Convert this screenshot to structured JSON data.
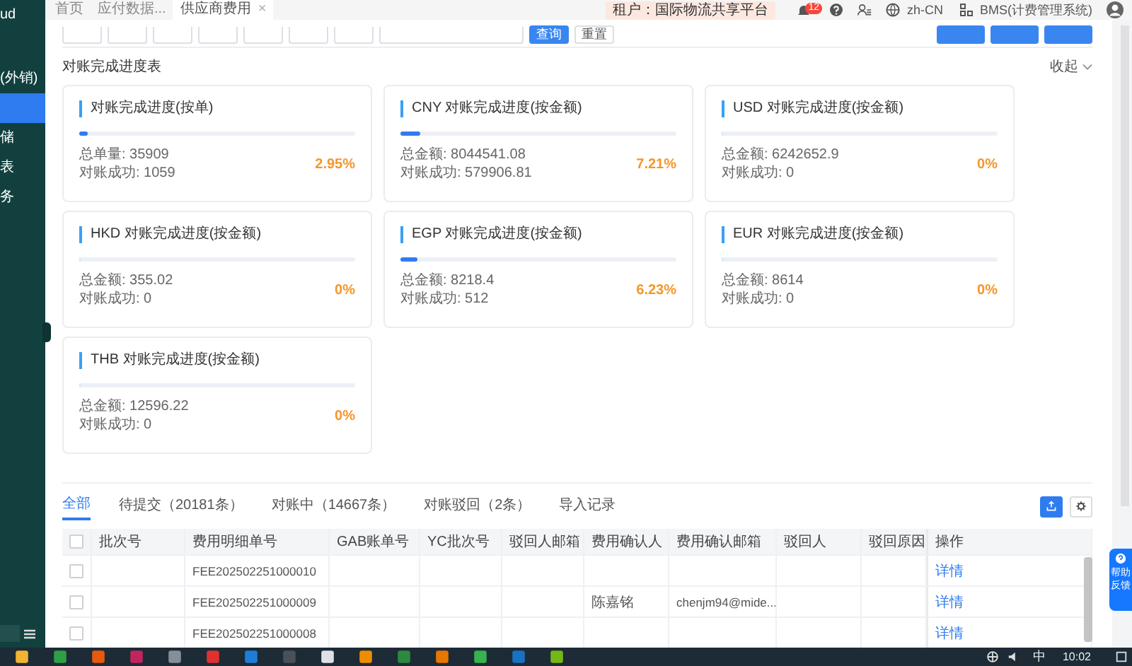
{
  "sidebar": {
    "items": [
      {
        "label": "ud",
        "selected": false
      },
      {
        "label": "(外销)",
        "selected": false
      },
      {
        "selected": true
      },
      {
        "label": "储",
        "selected": false
      },
      {
        "label": "表",
        "selected": false
      },
      {
        "label": "务",
        "selected": false
      }
    ]
  },
  "page_tabs": [
    {
      "label": "首页",
      "selected": false
    },
    {
      "label": "应付数据...",
      "selected": false
    },
    {
      "label": "供应商费用",
      "selected": true,
      "close": "×"
    }
  ],
  "header": {
    "tenant": "租户：国际物流共享平台",
    "notification_count": "12",
    "language": "zh-CN",
    "system": "BMS(计费管理系统)"
  },
  "filters": [
    {
      "kind": "input"
    },
    {
      "kind": "input"
    },
    {
      "kind": "input"
    },
    {
      "kind": "input"
    },
    {
      "kind": "input"
    },
    {
      "kind": "input"
    },
    {
      "kind": "input"
    },
    {
      "kind": "date"
    }
  ],
  "filter_buttons": [
    {
      "label": "查询",
      "primary": true
    },
    {
      "label": "重置",
      "primary": false
    }
  ],
  "action_buttons": [
    {
      "primary": true
    },
    {
      "primary": true
    },
    {
      "primary": true
    }
  ],
  "progress_section": {
    "title": "对账完成进度表",
    "collapse": "收起",
    "cards": [
      {
        "title": "对账完成进度(按单)",
        "level": 0.0295,
        "lines": [
          "总单量: 35909",
          "对账成功: 1059"
        ],
        "percent": "2.95%"
      },
      {
        "title": "CNY 对账完成进度(按金额)",
        "level": 0.0721,
        "lines": [
          "总金额: 8044541.08",
          "对账成功: 579906.81"
        ],
        "percent": "7.21%"
      },
      {
        "title": "USD 对账完成进度(按金额)",
        "level": 0,
        "lines": [
          "总金额: 6242652.9",
          "对账成功: 0"
        ],
        "percent": "0%"
      },
      {
        "title": "HKD 对账完成进度(按金额)",
        "level": 0,
        "lines": [
          "总金额: 355.02",
          "对账成功: 0"
        ],
        "percent": "0%"
      },
      {
        "title": "EGP 对账完成进度(按金额)",
        "level": 0.0623,
        "lines": [
          "总金额: 8218.4",
          "对账成功: 512"
        ],
        "percent": "6.23%"
      },
      {
        "title": "EUR 对账完成进度(按金额)",
        "level": 0,
        "lines": [
          "总金额: 8614",
          "对账成功: 0"
        ],
        "percent": "0%"
      },
      {
        "title": "THB 对账完成进度(按金额)",
        "level": 0,
        "lines": [
          "总金额: 12596.22",
          "对账成功: 0"
        ],
        "percent": "0%"
      }
    ]
  },
  "list_tabs": [
    {
      "label": "全部",
      "selected": true
    },
    {
      "label": "待提交（20181条）",
      "selected": false
    },
    {
      "label": "对账中（14667条）",
      "selected": false
    },
    {
      "label": "对账驳回（2条）",
      "selected": false
    },
    {
      "label": "导入记录",
      "selected": false
    }
  ],
  "table": {
    "select_all_checked": false,
    "columns": [
      "批次号",
      "费用明细单号",
      "GAB账单号",
      "YC批次号",
      "驳回人邮箱",
      "费用确认人",
      "费用确认邮箱",
      "驳回人",
      "驳回原因",
      "操作"
    ],
    "rows": [
      {
        "checked": false,
        "fee_no": "FEE202502251000010",
        "action": "详情"
      },
      {
        "checked": false,
        "fee_no": "FEE202502251000009",
        "confirmer": "陈嘉铭",
        "confirm_email": "chenjm94@mide...",
        "action": "详情"
      },
      {
        "checked": false,
        "fee_no": "FEE202502251000008",
        "action": "详情"
      }
    ]
  },
  "help_button": {
    "lines": [
      "帮助",
      "反馈"
    ]
  },
  "taskbar": {
    "ime": "中",
    "time": "10:02"
  }
}
